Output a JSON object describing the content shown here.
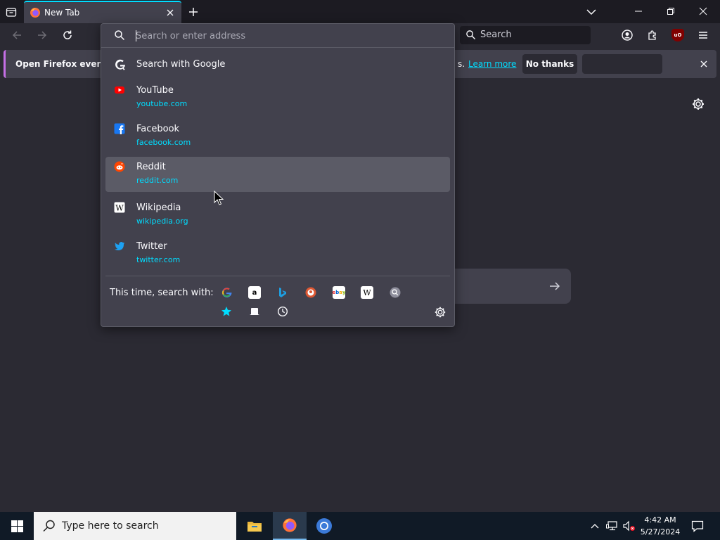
{
  "tab": {
    "title": "New Tab"
  },
  "navbar": {
    "search_label": "Search",
    "ublock_label": "uO"
  },
  "notification": {
    "message": "Open Firefox every time you start your device",
    "message_visible": "Open Firefox every ti",
    "tail": "s.",
    "learn_more": "Learn more",
    "no_thanks": "No thanks"
  },
  "urlbar": {
    "placeholder": "Search or enter address",
    "value": "",
    "search_with_google": "Search with Google",
    "suggestions": [
      {
        "title": "YouTube",
        "url": "youtube.com",
        "icon": "youtube-icon"
      },
      {
        "title": "Facebook",
        "url": "facebook.com",
        "icon": "facebook-icon"
      },
      {
        "title": "Reddit",
        "url": "reddit.com",
        "icon": "reddit-icon",
        "selected": true
      },
      {
        "title": "Wikipedia",
        "url": "wikipedia.org",
        "icon": "wikipedia-icon"
      },
      {
        "title": "Twitter",
        "url": "twitter.com",
        "icon": "twitter-icon"
      }
    ],
    "search_with_label": "This time, search with:",
    "engines": [
      "google-icon",
      "amazon-icon",
      "bing-icon",
      "duckduckgo-icon",
      "ebay-icon",
      "wikipedia-icon",
      "search-engine-icon"
    ],
    "modes": [
      "bookmarks-icon",
      "tabs-icon",
      "history-icon"
    ]
  },
  "taskbar": {
    "search_placeholder": "Type here to search",
    "time": "4:42 AM",
    "date": "5/27/2024"
  },
  "colors": {
    "accent": "#00ddff",
    "toolbar": "#2b2a33",
    "popup": "#42414d",
    "tabstrip": "#1c1b22",
    "ublock": "#800000"
  }
}
